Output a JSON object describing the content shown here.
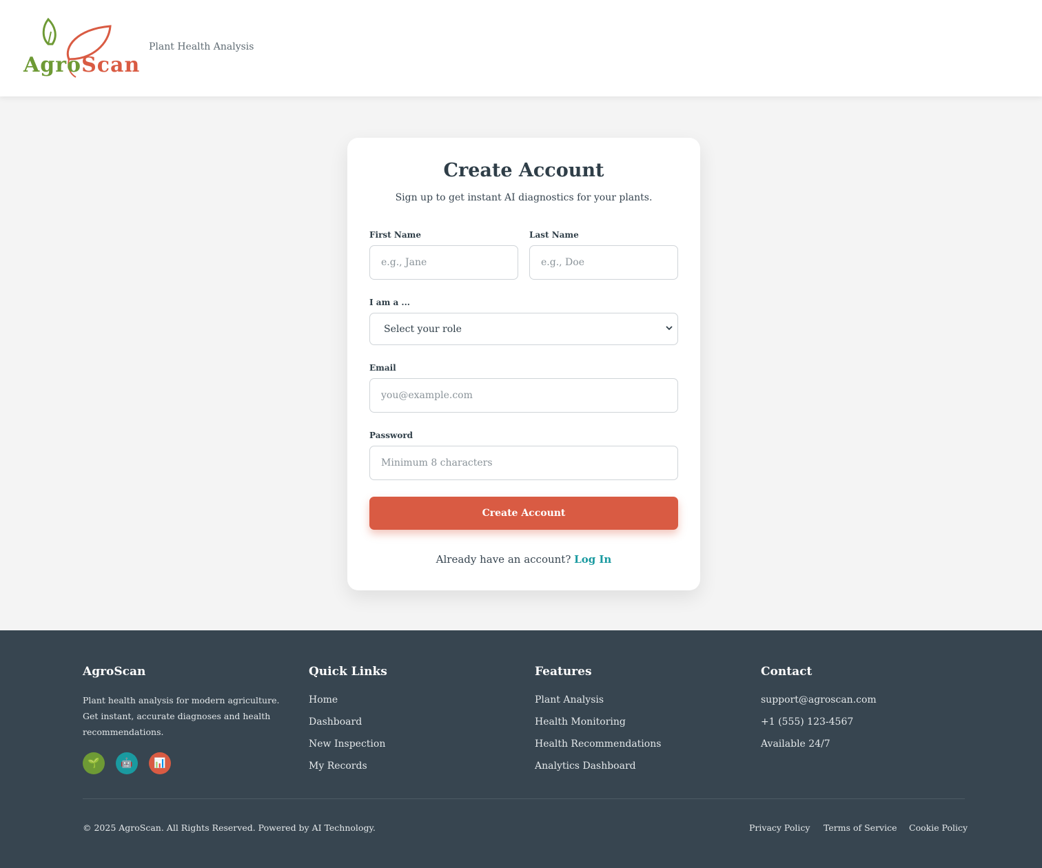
{
  "header": {
    "logo_text_a": "Agro",
    "logo_text_b": "Scan",
    "tagline": "Plant Health Analysis"
  },
  "card": {
    "title": "Create Account",
    "subtitle": "Sign up to get instant AI diagnostics for your plants.",
    "first_name": {
      "label": "First Name",
      "placeholder": "e.g., Jane",
      "value": ""
    },
    "last_name": {
      "label": "Last Name",
      "placeholder": "e.g., Doe",
      "value": ""
    },
    "role": {
      "label": "I am a ...",
      "selected": "Select your role"
    },
    "email": {
      "label": "Email",
      "placeholder": "you@example.com",
      "value": ""
    },
    "password": {
      "label": "Password",
      "placeholder": "Minimum 8 characters",
      "value": ""
    },
    "submit_label": "Create Account",
    "already_text": "Already have an account?",
    "login_link": "Log In"
  },
  "footer": {
    "brand": {
      "title": "AgroScan",
      "description": "Plant health analysis for modern agriculture. Get instant, accurate diagnoses and health recommendations.",
      "socials": [
        {
          "icon": "seedling-icon",
          "glyph": "🌱",
          "color": "#6e9a35"
        },
        {
          "icon": "robot-icon",
          "glyph": "🤖",
          "color": "#1a9aa0"
        },
        {
          "icon": "chart-icon",
          "glyph": "📊",
          "color": "#d95b43"
        }
      ]
    },
    "quick_links": {
      "title": "Quick Links",
      "items": [
        "Home",
        "Dashboard",
        "New Inspection",
        "My Records"
      ]
    },
    "features": {
      "title": "Features",
      "items": [
        "Plant Analysis",
        "Health Monitoring",
        "Health Recommendations",
        "Analytics Dashboard"
      ]
    },
    "contact": {
      "title": "Contact",
      "items": [
        "support@agroscan.com",
        "+1 (555) 123-4567",
        "Available 24/7"
      ]
    },
    "copyright": "© 2025 AgroScan. All Rights Reserved. Powered by AI Technology.",
    "legal": [
      "Privacy Policy",
      "Terms of Service",
      "Cookie Policy"
    ]
  },
  "colors": {
    "brand_green": "#6e9a35",
    "brand_red": "#d95b43",
    "link_teal": "#1a9aa0",
    "footer_bg": "#374550"
  }
}
